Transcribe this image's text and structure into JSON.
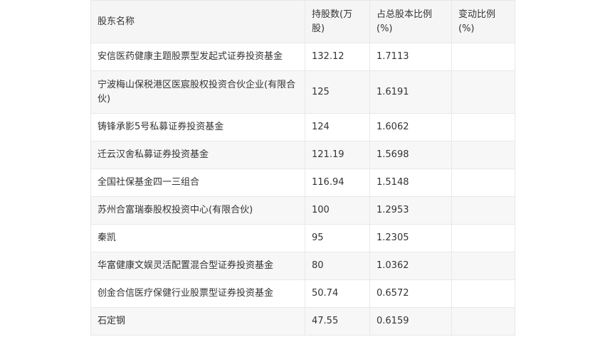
{
  "table": {
    "headers": [
      "股东名称",
      "持股数(万股)",
      "占总股本比例(%)",
      "变动比例(%)"
    ],
    "rows": [
      [
        "安信医药健康主题股票型发起式证券投资基金",
        "132.12",
        "1.7113",
        ""
      ],
      [
        "宁波梅山保税港区医宸股权投资合伙企业(有限合伙)",
        "125",
        "1.6191",
        ""
      ],
      [
        "铸锋承影5号私募证券投资基金",
        "124",
        "1.6062",
        ""
      ],
      [
        "迁云汉舍私募证券投资基金",
        "121.19",
        "1.5698",
        ""
      ],
      [
        "全国社保基金四一三组合",
        "116.94",
        "1.5148",
        ""
      ],
      [
        "苏州合富瑞泰股权投资中心(有限合伙)",
        "100",
        "1.2953",
        ""
      ],
      [
        "秦凯",
        "95",
        "1.2305",
        ""
      ],
      [
        "华富健康文娱灵活配置混合型证券投资基金",
        "80",
        "1.0362",
        ""
      ],
      [
        "创金合信医疗保健行业股票型证券投资基金",
        "50.74",
        "0.6572",
        ""
      ],
      [
        "石定钢",
        "47.55",
        "0.6159",
        ""
      ]
    ]
  }
}
